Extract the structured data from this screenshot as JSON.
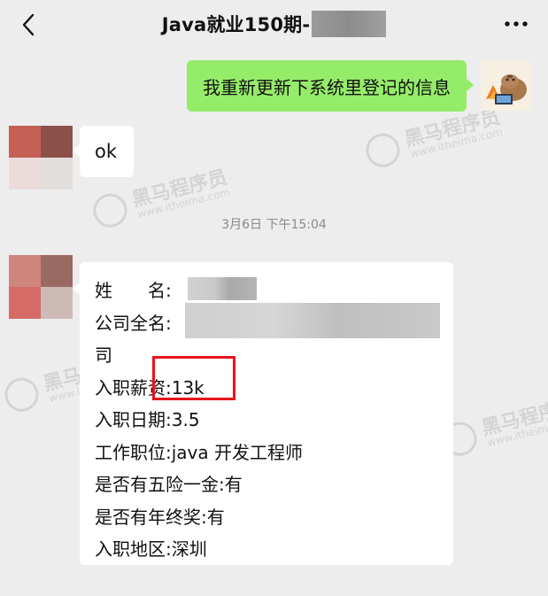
{
  "header": {
    "title": "Java就业150期-",
    "back_icon": "chevron-left-icon",
    "more_icon": "ellipsis-icon"
  },
  "messages": {
    "self_text": "我重新更新下系统里登记的信息",
    "ok_text": "ok",
    "timestamp": "3月6日 下午15:04",
    "info_lines": [
      "姓　　名:",
      "公司全名:",
      "司",
      "入职薪资:13k",
      "入职日期:3.5",
      "工作职位:java 开发工程师",
      "是否有五险一金:有",
      "是否有年终奖:有",
      "入职地区:深圳"
    ]
  },
  "watermark": {
    "brand": "黑马程序员",
    "url": "www.itheima.com"
  },
  "colors": {
    "background": "#ededed",
    "self_bubble": "#95ec69",
    "other_bubble": "#ffffff",
    "highlight": "#e8141c",
    "timestamp": "#8a8a8a"
  }
}
